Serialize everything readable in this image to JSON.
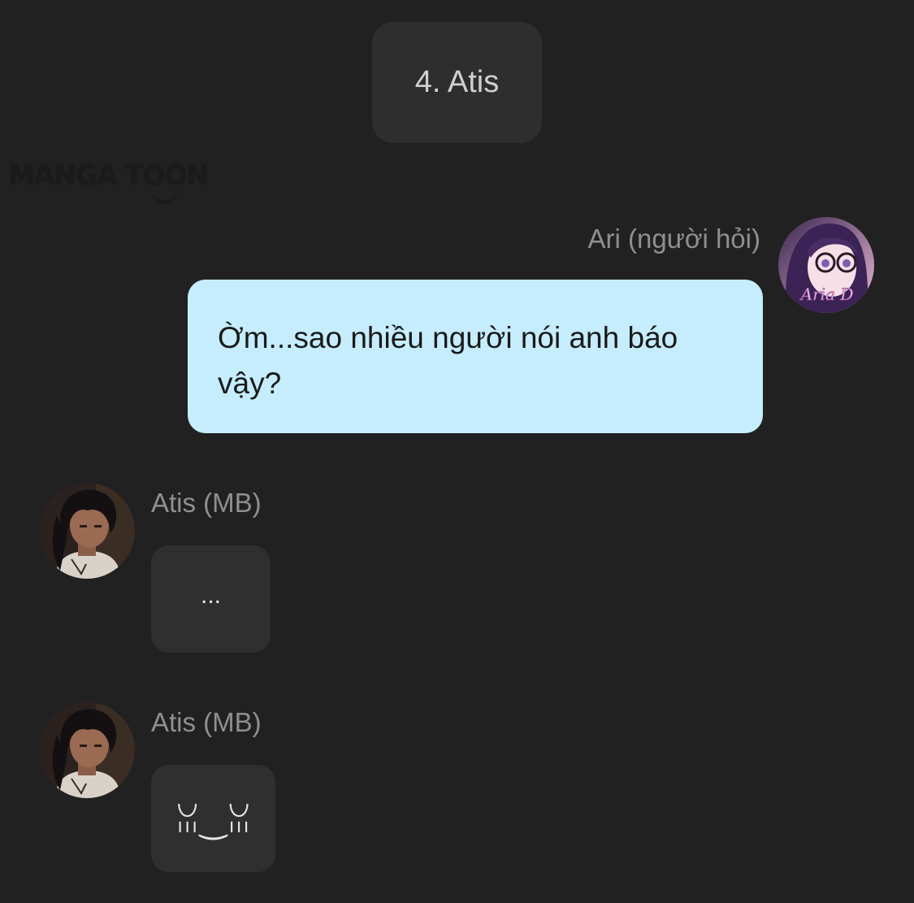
{
  "chapter": {
    "label": "4. Atis"
  },
  "watermark": {
    "text": "MANGA TOON"
  },
  "messages": [
    {
      "sender": "Ari (người hỏi)",
      "text": "Ờm...sao nhiều người nói anh báo vậy?",
      "avatar_caption": "Aria D"
    },
    {
      "sender": "Atis (MB)",
      "text": "..."
    },
    {
      "sender": "Atis (MB)",
      "text": "ꈍ‿ꈍ"
    }
  ],
  "colors": {
    "background": "#212121",
    "outgoing_bubble": "#c5edfd",
    "incoming_bubble": "#2f2f2f",
    "sender_name": "#8f8f8f"
  }
}
